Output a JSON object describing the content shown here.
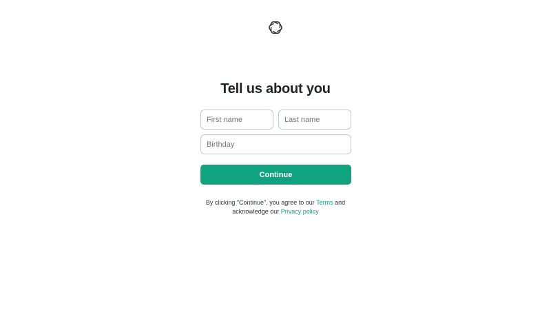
{
  "logo": {
    "icon": "openai-logo-icon",
    "color": "#2d333a"
  },
  "heading": {
    "title": "Tell us about you"
  },
  "form": {
    "first_name": {
      "placeholder": "First name",
      "value": ""
    },
    "last_name": {
      "placeholder": "Last name",
      "value": ""
    },
    "birthday": {
      "placeholder": "Birthday",
      "value": ""
    },
    "continue_label": "Continue",
    "accent_color": "#10a37f"
  },
  "legal": {
    "prefix": "By clicking \"Continue\", you agree to our ",
    "terms_link": "Terms",
    "middle": " and",
    "line2_prefix": "acknowledge our ",
    "privacy_link": "Privacy policy"
  }
}
